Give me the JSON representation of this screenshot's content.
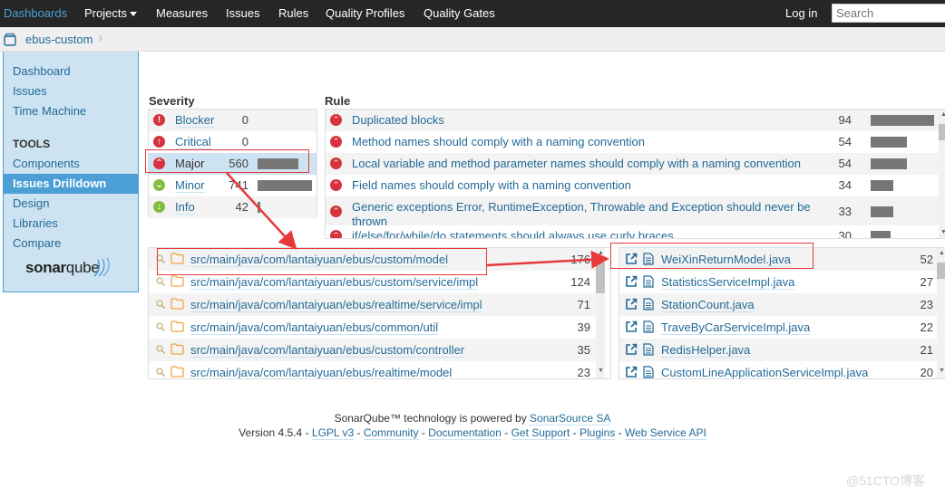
{
  "nav": {
    "items": [
      {
        "label": "Dashboards",
        "active": true
      },
      {
        "label": "Projects",
        "has_caret": true
      },
      {
        "label": "Measures"
      },
      {
        "label": "Issues"
      },
      {
        "label": "Rules"
      },
      {
        "label": "Quality Profiles"
      },
      {
        "label": "Quality Gates"
      }
    ],
    "login": "Log in",
    "search_placeholder": "Search"
  },
  "breadcrumb": {
    "icon": "project-icon",
    "project": "ebus-custom",
    "separator": "›"
  },
  "sidebar": {
    "items": [
      {
        "label": "Dashboard"
      },
      {
        "label": "Issues"
      },
      {
        "label": "Time Machine"
      }
    ],
    "tools_heading": "TOOLS",
    "tools": [
      {
        "label": "Components"
      },
      {
        "label": "Issues Drilldown",
        "active": true
      },
      {
        "label": "Design"
      },
      {
        "label": "Libraries"
      },
      {
        "label": "Compare"
      }
    ],
    "logo_bold": "sonar",
    "logo_light": "qube"
  },
  "severity": {
    "heading": "Severity",
    "rows": [
      {
        "name": "Blocker",
        "count": "0",
        "icon": "blocker-icon",
        "color": "#d4333f",
        "share": 0
      },
      {
        "name": "Critical",
        "count": "0",
        "icon": "critical-icon",
        "color": "#d4333f",
        "share": 0
      },
      {
        "name": "Major",
        "count": "560",
        "icon": "major-icon",
        "color": "#d4333f",
        "share": 0.756,
        "selected": true
      },
      {
        "name": "Minor",
        "count": "741",
        "icon": "minor-icon",
        "color": "#85bb43",
        "share": 1.0
      },
      {
        "name": "Info",
        "count": "42",
        "icon": "info-icon",
        "color": "#85bb43",
        "share": 0.057
      }
    ]
  },
  "rules": {
    "heading": "Rule",
    "rows": [
      {
        "name": "Duplicated blocks",
        "count": "94",
        "share": 1.0
      },
      {
        "name": "Method names should comply with a naming convention",
        "count": "54",
        "share": 0.574
      },
      {
        "name": "Local variable and method parameter names should comply with a naming convention",
        "count": "54",
        "share": 0.574
      },
      {
        "name": "Field names should comply with a naming convention",
        "count": "34",
        "share": 0.362
      },
      {
        "name": "Generic exceptions Error, RuntimeException, Throwable and Exception should never be thrown",
        "count": "33",
        "share": 0.351
      },
      {
        "name": "if/else/for/while/do statements should always use curly braces",
        "count": "30",
        "share": 0.319
      }
    ]
  },
  "directories": {
    "rows": [
      {
        "path": "src/main/java/com/lantaiyuan/ebus/custom/model",
        "count": "176"
      },
      {
        "path": "src/main/java/com/lantaiyuan/ebus/custom/service/impl",
        "count": "124"
      },
      {
        "path": "src/main/java/com/lantaiyuan/ebus/realtime/service/impl",
        "count": "71"
      },
      {
        "path": "src/main/java/com/lantaiyuan/ebus/common/util",
        "count": "39"
      },
      {
        "path": "src/main/java/com/lantaiyuan/ebus/custom/controller",
        "count": "35"
      },
      {
        "path": "src/main/java/com/lantaiyuan/ebus/realtime/model",
        "count": "23"
      }
    ]
  },
  "files": {
    "rows": [
      {
        "name": "WeiXinReturnModel.java",
        "count": "52"
      },
      {
        "name": "StatisticsServiceImpl.java",
        "count": "27"
      },
      {
        "name": "StationCount.java",
        "count": "23"
      },
      {
        "name": "TraveByCarServiceImpl.java",
        "count": "22"
      },
      {
        "name": "RedisHelper.java",
        "count": "21"
      },
      {
        "name": "CustomLineApplicationServiceImpl.java",
        "count": "20"
      }
    ]
  },
  "footer": {
    "line1_prefix": "SonarQube™ technology is powered by ",
    "line1_link": "SonarSource SA",
    "version": "Version 4.5.4",
    "sep": " - ",
    "links": [
      "LGPL v3",
      "Community",
      "Documentation",
      "Get Support",
      "Plugins",
      "Web Service API"
    ]
  },
  "watermark": "@51CTO博客",
  "colors": {
    "nav_bg": "#262626",
    "accent": "#4b9fd5",
    "link": "#236a97",
    "sidebar_bg": "#cde3f2",
    "severity_red": "#d4333f",
    "severity_green": "#85bb43",
    "bar": "#777777",
    "annotation": "#e8393a"
  }
}
